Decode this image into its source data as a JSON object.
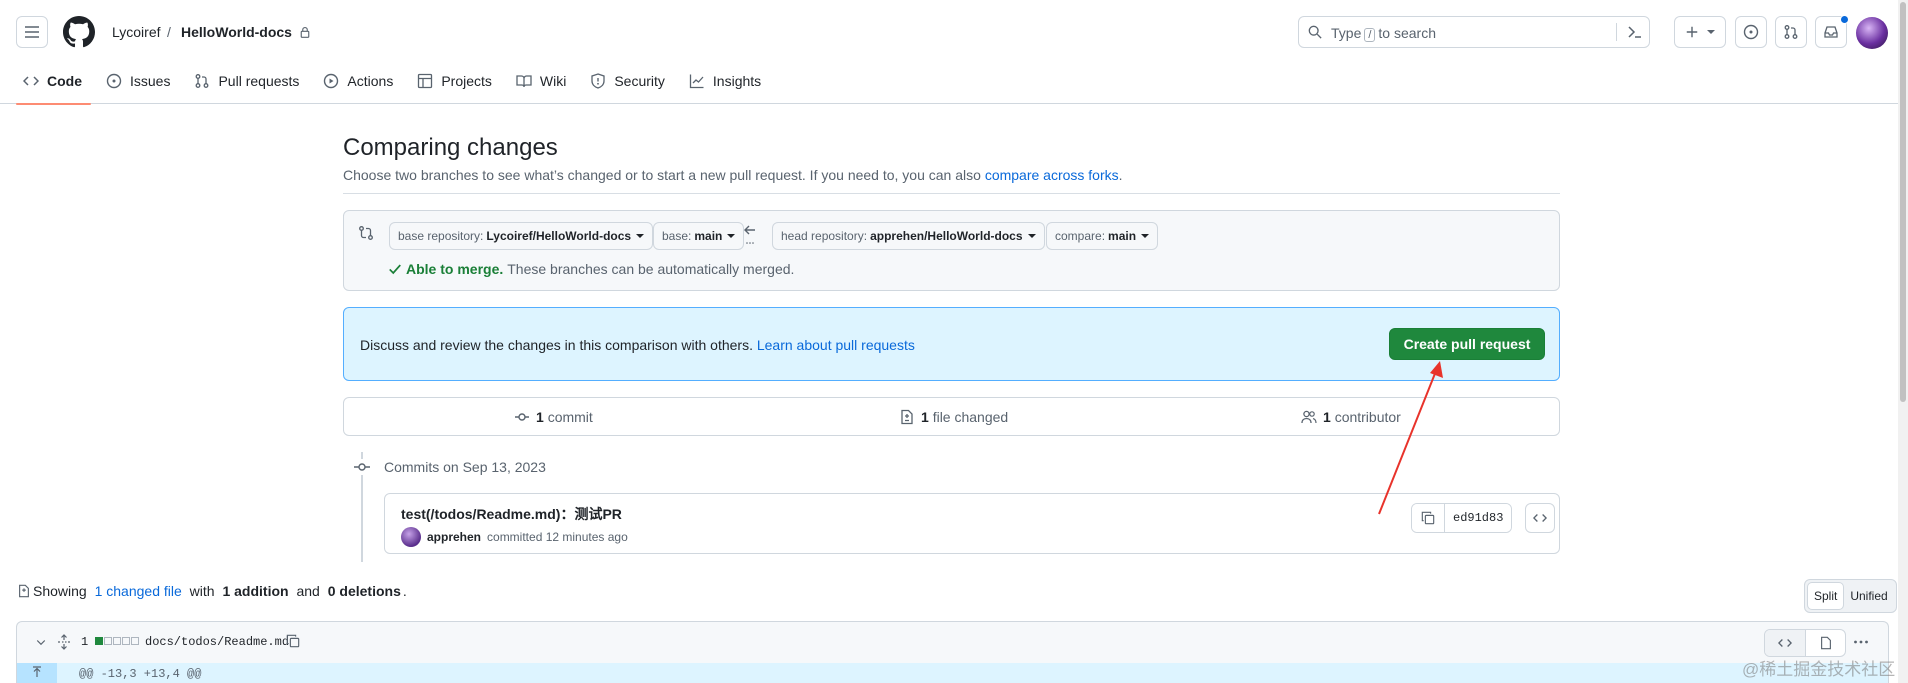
{
  "header": {
    "owner": "Lycoiref",
    "separator": "/",
    "repo": "HelloWorld-docs",
    "search": {
      "prefix": "Type",
      "key": "/",
      "suffix": "to search"
    }
  },
  "repo_nav": [
    {
      "label": "Code",
      "icon": "code-icon",
      "active": true
    },
    {
      "label": "Issues",
      "icon": "issue-opened-icon"
    },
    {
      "label": "Pull requests",
      "icon": "git-pull-request-icon"
    },
    {
      "label": "Actions",
      "icon": "play-icon"
    },
    {
      "label": "Projects",
      "icon": "table-icon"
    },
    {
      "label": "Wiki",
      "icon": "book-icon"
    },
    {
      "label": "Security",
      "icon": "shield-icon"
    },
    {
      "label": "Insights",
      "icon": "graph-icon"
    }
  ],
  "compare": {
    "title": "Comparing changes",
    "subtitle": "Choose two branches to see what’s changed or to start a new pull request. If you need to, you can also",
    "subtitle_link": "compare across forks",
    "subtitle_end": ".",
    "base_repo_label": "base repository:",
    "base_repo": "Lycoiref/HelloWorld-docs",
    "base_label": "base:",
    "base": "main",
    "head_repo_label": "head repository:",
    "head_repo": "apprehen/HelloWorld-docs",
    "compare_label": "compare:",
    "compare_branch": "main",
    "merge_status": "Able to merge.",
    "merge_note": "These branches can be automatically merged."
  },
  "flash": {
    "text": "Discuss and review the changes in this comparison with others.",
    "link": "Learn about pull requests",
    "button": "Create pull request"
  },
  "stats": {
    "commits_count": "1",
    "commits_label": "commit",
    "files_count": "1",
    "files_label": "file changed",
    "contributors_count": "1",
    "contributors_label": "contributor"
  },
  "commits": {
    "heading": "Commits on Sep 13, 2023",
    "message": "test(/todos/Readme.md)：测试PR",
    "author": "apprehen",
    "meta": "committed 12 minutes ago",
    "sha": "ed91d83"
  },
  "diff": {
    "showing": "Showing",
    "changed_link": "1 changed file",
    "with": "with",
    "additions": "1 addition",
    "and": "and",
    "deletions": "0 deletions",
    "end": ".",
    "split": "Split",
    "unified": "Unified",
    "file_count": "1",
    "file_path": "docs/todos/Readme.md",
    "hunk": "@@ -13,3 +13,4 @@"
  },
  "watermark": "@稀土掘金技术社区",
  "colors": {
    "primary_button": "#1f883d",
    "link": "#0969da",
    "active_tab_underline": "#fd8c73",
    "flash_bg": "#ddf4ff",
    "merge_ok": "#1a7f37",
    "annotation_arrow": "#e8332b"
  }
}
